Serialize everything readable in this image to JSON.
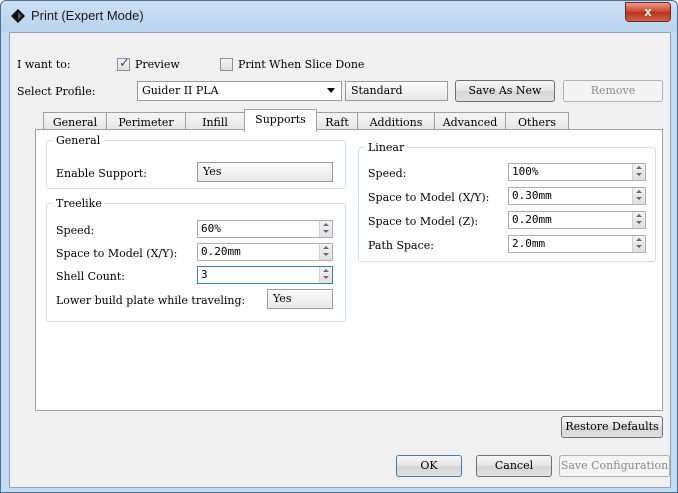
{
  "window": {
    "title": "Print (Expert Mode)",
    "close_label": "x"
  },
  "top": {
    "want_label": "I want to:",
    "preview": {
      "label": "Preview",
      "checked": true
    },
    "print_when_done": {
      "label": "Print When Slice Done",
      "checked": false
    },
    "profile_label": "Select Profile:",
    "profile_value": "Guider II PLA",
    "quality_value": "Standard",
    "save_as_new": "Save As New",
    "remove": "Remove"
  },
  "tabs": [
    "General",
    "Perimeter",
    "Infill",
    "Supports",
    "Raft",
    "Additions",
    "Advanced",
    "Others"
  ],
  "active_tab": "Supports",
  "general_group": {
    "title": "General",
    "enable_support_label": "Enable Support:",
    "enable_support_value": "Yes"
  },
  "treelike_group": {
    "title": "Treelike",
    "speed_label": "Speed:",
    "speed_value": "60%",
    "space_xy_label": "Space to Model (X/Y):",
    "space_xy_value": "0.20mm",
    "shell_count_label": "Shell Count:",
    "shell_count_value": "3",
    "lower_plate_label": "Lower build plate while traveling:",
    "lower_plate_value": "Yes"
  },
  "linear_group": {
    "title": "Linear",
    "speed_label": "Speed:",
    "speed_value": "100%",
    "space_xy_label": "Space to Model (X/Y):",
    "space_xy_value": "0.30mm",
    "space_z_label": "Space to Model (Z):",
    "space_z_value": "0.20mm",
    "path_space_label": "Path Space:",
    "path_space_value": "2.0mm"
  },
  "footer": {
    "restore_defaults": "Restore Defaults",
    "ok": "OK",
    "cancel": "Cancel",
    "save_config": "Save Configuration"
  }
}
